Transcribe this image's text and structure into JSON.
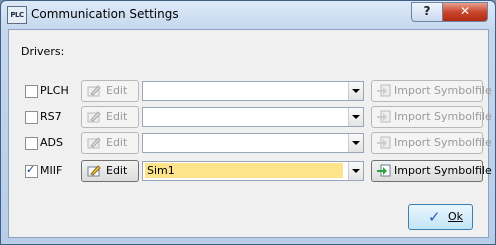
{
  "window": {
    "title": "Communication Settings",
    "icon_text": "PLC",
    "help_label": "?",
    "close_label": "✕"
  },
  "dialog": {
    "drivers_label": "Drivers:",
    "drivers": [
      {
        "name": "PLCH",
        "checked": false,
        "edit_label": "Edit",
        "edit_enabled": false,
        "selected_value": "",
        "import_label": "Import Symbolfile",
        "import_enabled": false
      },
      {
        "name": "RS7",
        "checked": false,
        "edit_label": "Edit",
        "edit_enabled": false,
        "selected_value": "",
        "import_label": "Import Symbolfile",
        "import_enabled": false
      },
      {
        "name": "ADS",
        "checked": false,
        "edit_label": "Edit",
        "edit_enabled": false,
        "selected_value": "",
        "import_label": "Import Symbolfile",
        "import_enabled": false
      },
      {
        "name": "MIIF",
        "checked": true,
        "edit_label": "Edit",
        "edit_enabled": true,
        "selected_value": "Sim1",
        "import_label": "Import Symbolfile",
        "import_enabled": true
      }
    ],
    "ok_label": "Ok"
  },
  "icons": {
    "edit": "pencil-edit-icon",
    "import": "import-arrow-icon",
    "ok": "checkmark-icon"
  },
  "colors": {
    "title_bar": "#c4d7ee",
    "close_button": "#c8452c",
    "selection_highlight": "#fde48a",
    "ok_button": "#c2e4f6"
  }
}
